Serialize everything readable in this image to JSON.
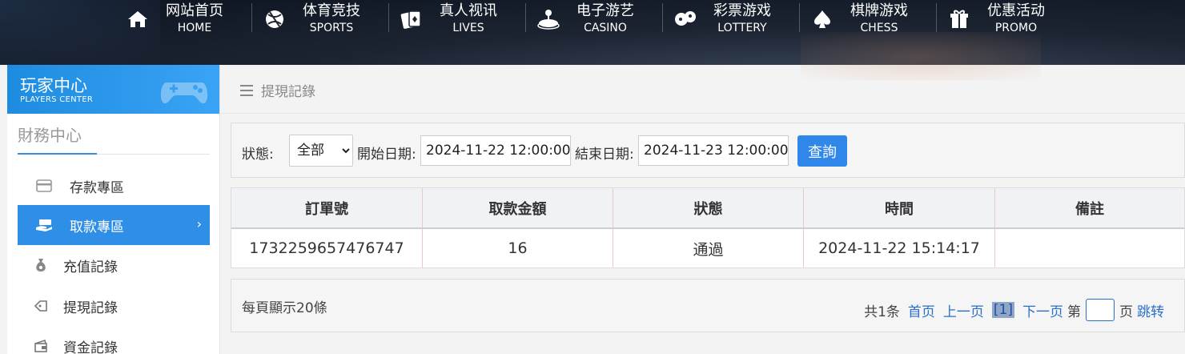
{
  "nav": [
    {
      "cn": "网站首页",
      "en": "HOME",
      "icon": "home-icon"
    },
    {
      "cn": "体育竞技",
      "en": "SPORTS",
      "icon": "ball-icon"
    },
    {
      "cn": "真人视讯",
      "en": "LIVES",
      "icon": "cards-icon"
    },
    {
      "cn": "电子游艺",
      "en": "CASINO",
      "icon": "joystick-icon"
    },
    {
      "cn": "彩票游戏",
      "en": "LOTTERY",
      "icon": "dice-icon"
    },
    {
      "cn": "棋牌游戏",
      "en": "CHESS",
      "icon": "spade-icon"
    },
    {
      "cn": "优惠活动",
      "en": "PROMO",
      "icon": "gift-icon"
    }
  ],
  "sidebar": {
    "header_cn": "玩家中心",
    "header_en": "PLAYERS CENTER",
    "section_title": "財務中心",
    "items": [
      {
        "label": "存款專區",
        "icon": "card-icon",
        "active": false
      },
      {
        "label": "取款專區",
        "icon": "cash-hand-icon",
        "active": true
      },
      {
        "label": "充值記錄",
        "icon": "money-bag-icon",
        "active": false
      },
      {
        "label": "提現記錄",
        "icon": "tag-icon",
        "active": false
      },
      {
        "label": "資金記錄",
        "icon": "wallet-icon",
        "active": false
      }
    ]
  },
  "breadcrumb": "提現記錄",
  "filter": {
    "status_label": "狀態:",
    "status_value": "全部",
    "start_label": "開始日期:",
    "start_value": "2024-11-22 12:00:00",
    "end_label": "結束日期:",
    "end_value": "2024-11-23 12:00:00",
    "query_label": "查詢"
  },
  "table": {
    "headers": [
      "訂單號",
      "取款金額",
      "狀態",
      "時間",
      "備註"
    ],
    "rows": [
      [
        "1732259657476747",
        "16",
        "通過",
        "2024-11-22 15:14:17",
        ""
      ]
    ]
  },
  "pager": {
    "per_page": "每頁顯示20條",
    "total": "共1条",
    "first": "首页",
    "prev": "上一页",
    "current": "[1]",
    "next": "下一页",
    "goto_prefix": "第",
    "goto_suffix": "页",
    "jump": "跳转"
  },
  "colors": {
    "accent": "#2f8fe6",
    "query_button": "#2f87ea",
    "link": "#2a6fc9"
  }
}
